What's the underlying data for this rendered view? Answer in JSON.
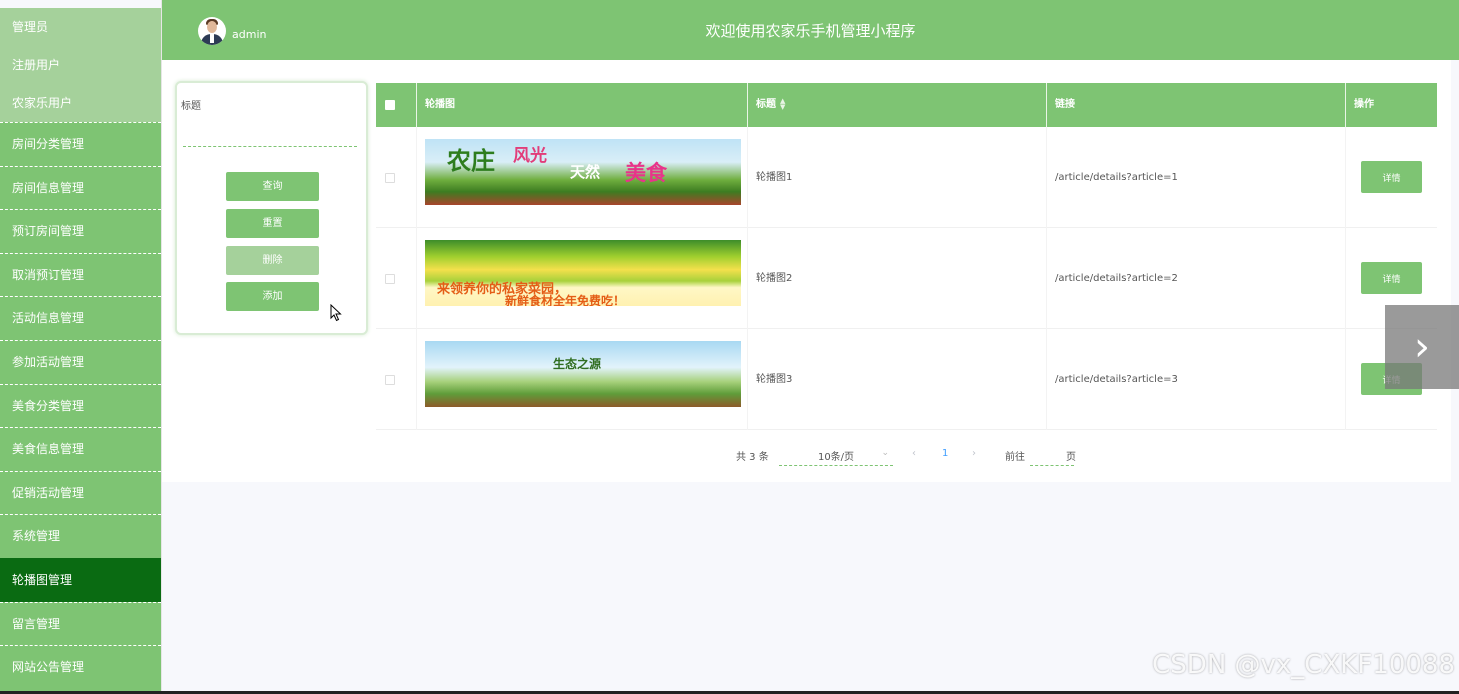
{
  "sidebar": {
    "sub_items": [
      "管理员",
      "注册用户",
      "农家乐用户"
    ],
    "items": [
      "房间分类管理",
      "房间信息管理",
      "预订房间管理",
      "取消预订管理",
      "活动信息管理",
      "参加活动管理",
      "美食分类管理",
      "美食信息管理",
      "促销活动管理",
      "系统管理",
      "轮播图管理",
      "留言管理",
      "网站公告管理"
    ],
    "active": "轮播图管理"
  },
  "header": {
    "username": "admin",
    "title": "欢迎使用农家乐手机管理小程序"
  },
  "search": {
    "label": "标题",
    "value": "",
    "buttons": {
      "query": "查询",
      "reset": "重置",
      "delete": "删除",
      "add": "添加"
    }
  },
  "table": {
    "headers": {
      "image": "轮播图",
      "title": "标题",
      "link": "链接",
      "op": "操作"
    },
    "rows": [
      {
        "title": "轮播图1",
        "link": "/article/details?article=1",
        "action": "详情",
        "banner_text": [
          "农庄",
          "风光",
          "天然",
          "美食"
        ]
      },
      {
        "title": "轮播图2",
        "link": "/article/details?article=2",
        "action": "详情",
        "banner_text": [
          "来领养你的私家菜园，",
          "新鲜食材全年免费吃！"
        ]
      },
      {
        "title": "轮播图3",
        "link": "/article/details?article=3",
        "action": "详情",
        "banner_text": [
          "生态之源"
        ]
      }
    ]
  },
  "pagination": {
    "total": "共 3 条",
    "page_size": "10条/页",
    "current": "1",
    "goto_prefix": "前往",
    "goto_suffix": "页"
  },
  "watermark": "CSDN @vx_CXKF10088",
  "colors": {
    "primary": "#7ec473",
    "active": "#0a6b12",
    "light": "#a5d19b"
  }
}
